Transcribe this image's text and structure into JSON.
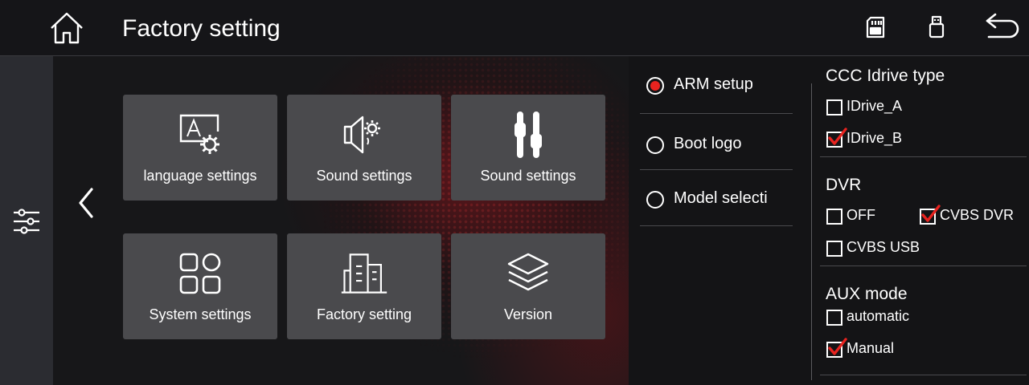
{
  "header": {
    "title": "Factory setting",
    "icons": [
      "home-icon",
      "sd-card-icon",
      "usb-icon",
      "back-arrow-icon"
    ]
  },
  "sidebar": {
    "icons": [
      "sliders-icon"
    ]
  },
  "main": {
    "prev_icon": "chevron-left-icon",
    "tiles": [
      {
        "label": "language settings",
        "icon": "language-gear-icon"
      },
      {
        "label": "Sound settings",
        "icon": "speaker-gear-icon"
      },
      {
        "label": "Sound settings",
        "icon": "equalizer-icon"
      },
      {
        "label": "System settings",
        "icon": "apps-grid-icon"
      },
      {
        "label": "Factory setting",
        "icon": "factory-building-icon"
      },
      {
        "label": "Version",
        "icon": "layers-icon"
      }
    ]
  },
  "menu": {
    "items": [
      {
        "label": "ARM setup",
        "selected": true
      },
      {
        "label": "Boot logo",
        "selected": false
      },
      {
        "label": "Model selecti",
        "selected": false
      }
    ]
  },
  "options": {
    "idrive": {
      "title": "CCC Idrive type",
      "items": [
        {
          "label": "IDrive_A",
          "checked": false
        },
        {
          "label": "IDrive_B",
          "checked": true
        }
      ]
    },
    "dvr": {
      "title": "DVR",
      "items": [
        {
          "label": "OFF",
          "checked": false
        },
        {
          "label": "CVBS DVR",
          "checked": true
        },
        {
          "label": "CVBS USB",
          "checked": false
        }
      ]
    },
    "aux": {
      "title": "AUX mode",
      "items": [
        {
          "label": "automatic",
          "checked": false
        },
        {
          "label": "Manual",
          "checked": true
        }
      ]
    }
  },
  "colors": {
    "accent": "#e8231f",
    "tile": "#4a4a4d",
    "sidebar": "#2b2c31",
    "background": "#141416"
  }
}
